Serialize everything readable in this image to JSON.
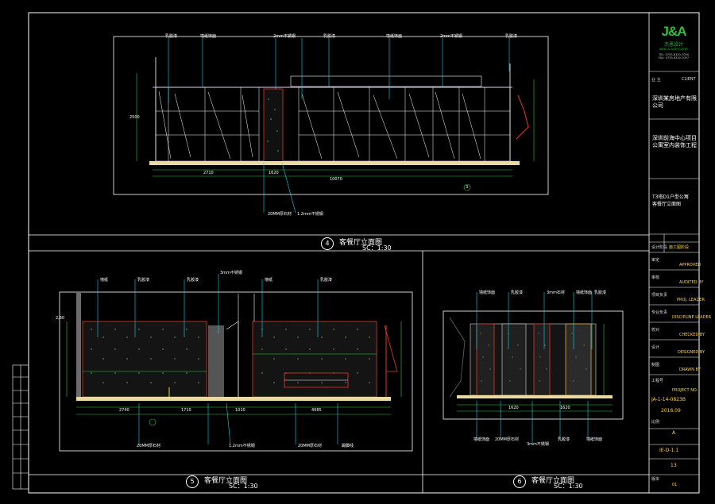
{
  "colors": {
    "frame": "#ffffff",
    "cyan": "#19d3e6",
    "red": "#e23a2a",
    "yellow": "#f2d34a",
    "green": "#2ecc40",
    "floor": "#ead9a0",
    "logo": "#2bbf3f"
  },
  "views": {
    "top": {
      "number": "4",
      "title": "客餐厅立面图",
      "scale": "SC：1:30"
    },
    "bottom_left": {
      "number": "5",
      "title": "客餐厅立面图",
      "scale": "SC：1:30"
    },
    "bottom_right": {
      "number": "6",
      "title": "客餐厅立面图",
      "scale": "SC：1:30"
    }
  },
  "top_annotations": {
    "labels_above": [
      "乳胶漆",
      "墙纸饰面",
      "2mm不锈钢",
      "乳胶漆",
      "墙纸饰面",
      "2mm不锈钢",
      "乳胶漆"
    ],
    "labels_below": [
      "20MM厚石材",
      "1.2mm不锈钢"
    ],
    "dims_bottom": [
      "2710",
      "1620",
      "10070"
    ],
    "left_dims": [
      "2500"
    ],
    "elevation_mark": "3"
  },
  "bottom_left_annotations": {
    "labels_above": [
      "墙纸",
      "乳胶漆",
      "乳胶漆",
      "3mm不锈钢",
      "墙纸",
      "乳胶漆"
    ],
    "labels_below": [
      "20MM厚石材",
      "1.2mm不锈钢",
      "20MM厚石材",
      "踢脚线"
    ],
    "dims_bottom": [
      "2740",
      "1710",
      "1010",
      "4085"
    ],
    "left_dim": "2,60"
  },
  "bottom_right_annotations": {
    "labels_above": [
      "墙纸饰面",
      "乳胶漆",
      "3mm石材",
      "墙纸饰面",
      "乳胶漆"
    ],
    "labels_below": [
      "墙纸饰面",
      "20MM厚石材",
      "3mm不锈钢",
      "乳胶漆",
      "墙纸饰面"
    ],
    "dims_bottom": [
      "1620",
      "1620"
    ]
  },
  "title_block": {
    "logo_text": "J&A",
    "company_cn": "杰恩设计",
    "company_en": "JIANG & ASSOCIATES",
    "contact_line1": "TEL: 0755-8320-7090",
    "contact_line2": "FAX: 0755-8320-7097",
    "client_label": "业  主",
    "client_value": "CLIENT",
    "client_name": "深圳某房地产有限公司",
    "project_name": "深圳前海中心项目\n公寓室内装饰工程",
    "drawing_name": "T3塔D1户型公寓\n客餐厅立面图",
    "rows": [
      {
        "k": "设计阶段",
        "v": "施工图阶段"
      },
      {
        "k": "审定",
        "v": "APPROVED"
      },
      {
        "k": "审核",
        "v": "AUDITED BY"
      },
      {
        "k": "项目负责",
        "v": "PROJ. LEADER"
      },
      {
        "k": "专业负责",
        "v": "DISCIPLINE LEADER"
      },
      {
        "k": "校对",
        "v": "CHECKED BY"
      },
      {
        "k": "设计",
        "v": "DESIGNED BY"
      },
      {
        "k": "制图",
        "v": "DRAWN BY"
      },
      {
        "k": "工程号",
        "v": "PROJECT NO."
      }
    ],
    "project_no": "JA-1-14-0823B",
    "date": "2016.09",
    "scale_label": "比例",
    "scale_value": "A",
    "drawing_no": "IE-D-1.1",
    "sheet_no": "13",
    "revision_label": "版本",
    "revision_value": "01"
  }
}
